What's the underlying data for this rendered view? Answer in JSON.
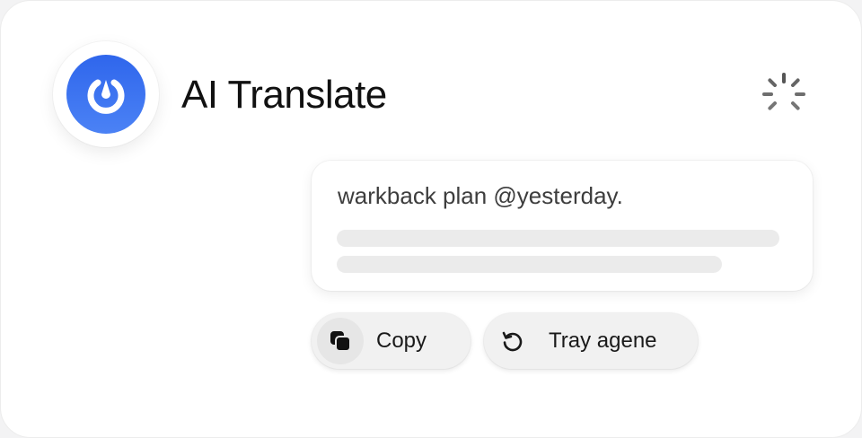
{
  "app": {
    "title": "AI Translate",
    "logo_icon": "ring-icon",
    "brand_color": "#2f66ec",
    "status_icon": "loading-spinner-icon"
  },
  "result": {
    "text": "warkback plan @yesterday."
  },
  "actions": {
    "copy": {
      "label": "Copy",
      "icon": "copy-icon"
    },
    "retry": {
      "label": "Tray agene",
      "icon": "refresh-icon"
    }
  }
}
